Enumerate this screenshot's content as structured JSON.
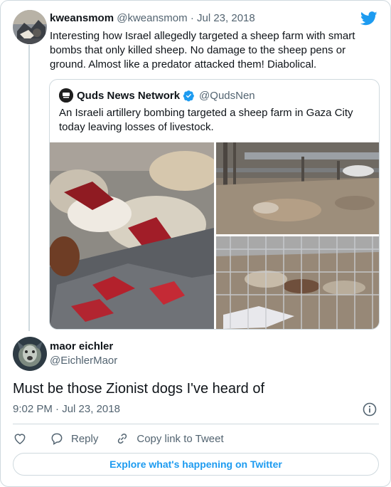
{
  "parent_tweet": {
    "display_name": "kweansmom",
    "handle": "@kweansmom",
    "separator": "·",
    "date": "Jul 23, 2018",
    "text": "Interesting how Israel allegedly targeted a sheep farm with smart bombs that only killed sheep. No damage to the sheep pens or ground. Almost like a predator attacked them! Diabolical."
  },
  "quoted_tweet": {
    "display_name": "Quds News Network",
    "handle": "@QudsNen",
    "verified": true,
    "text": "An Israeli artillery bombing targeted a sheep farm in Gaza City today leaving losses of livestock.",
    "media": [
      "photo-dead-sheep-closeup",
      "photo-sheep-pen-debris",
      "photo-sheep-behind-fence"
    ]
  },
  "reply_tweet": {
    "display_name": "maor eichler",
    "handle": "@EichlerMaor",
    "text": "Must be those Zionist dogs I've heard of",
    "time": "9:02 PM",
    "separator": "·",
    "date": "Jul 23, 2018"
  },
  "actions": {
    "reply_label": "Reply",
    "copy_link_label": "Copy link to Tweet"
  },
  "explore_label": "Explore what's happening on Twitter",
  "colors": {
    "twitter_blue": "#1d9bf0",
    "verified_blue": "#1d9bf0",
    "text_secondary": "#536471",
    "border": "#cfd9de"
  },
  "icons": [
    "twitter-bird-icon",
    "verified-badge-icon",
    "info-icon",
    "heart-icon",
    "reply-icon",
    "link-icon"
  ]
}
